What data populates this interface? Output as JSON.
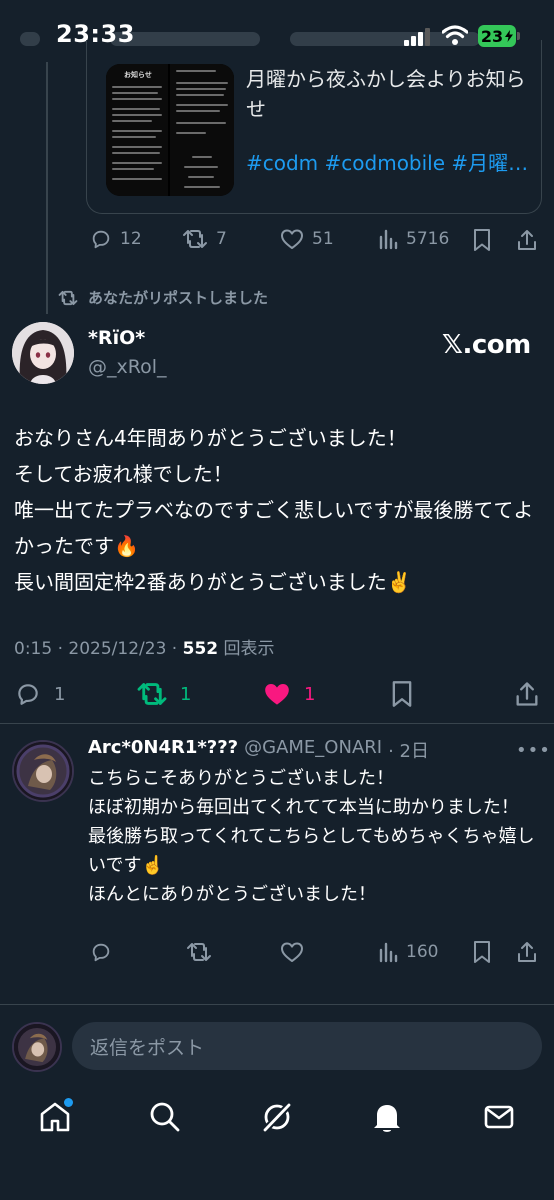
{
  "status_bar": {
    "time": "23:33",
    "battery": "23"
  },
  "quoted_post": {
    "text": "月曜から夜ふかし会よりお知らせ",
    "hashtags": "#codm  #codmobile #月曜…",
    "thumb_title": "お知らせ",
    "actions": {
      "replies": "12",
      "reposts": "7",
      "likes": "51",
      "views": "5716"
    }
  },
  "repost_banner": "あなたがリポストしました",
  "post": {
    "display_name": "*RïO*",
    "handle": "@_xRol_",
    "badge": "𝕏.com",
    "text": "おなりさん4年間ありがとうございました！\nそしてお疲れ様でした！\n唯一出てたプラベなのですごく悲しいですが最後勝ててよかったです🔥\n長い間固定枠2番ありがとうございました✌️",
    "time": "0:15",
    "date": "2025/12/23",
    "views_count": "552",
    "views_label": "回表示",
    "actions": {
      "replies": "1",
      "reposts": "1",
      "likes": "1"
    }
  },
  "reply": {
    "display_name": "Arc*0N4R1*???",
    "handle": "@GAME_ONARI",
    "age": "· 2日",
    "text": "こちらこそありがとうございました！\nほぼ初期から毎回出てくれてて本当に助かりました！\n最後勝ち取ってくれてこちらとしてもめちゃくちゃ嬉しいです☝️\nほんとにありがとうございました！",
    "actions": {
      "views": "160"
    }
  },
  "composer": {
    "placeholder": "返信をポスト"
  },
  "nav": [
    "home-icon",
    "search-icon",
    "grok-icon",
    "notifications-icon",
    "messages-icon"
  ],
  "colors": {
    "background": "#15202b",
    "link": "#1d9bf0",
    "like": "#f91880",
    "repost": "#00ba7c",
    "muted": "#8b98a5"
  }
}
